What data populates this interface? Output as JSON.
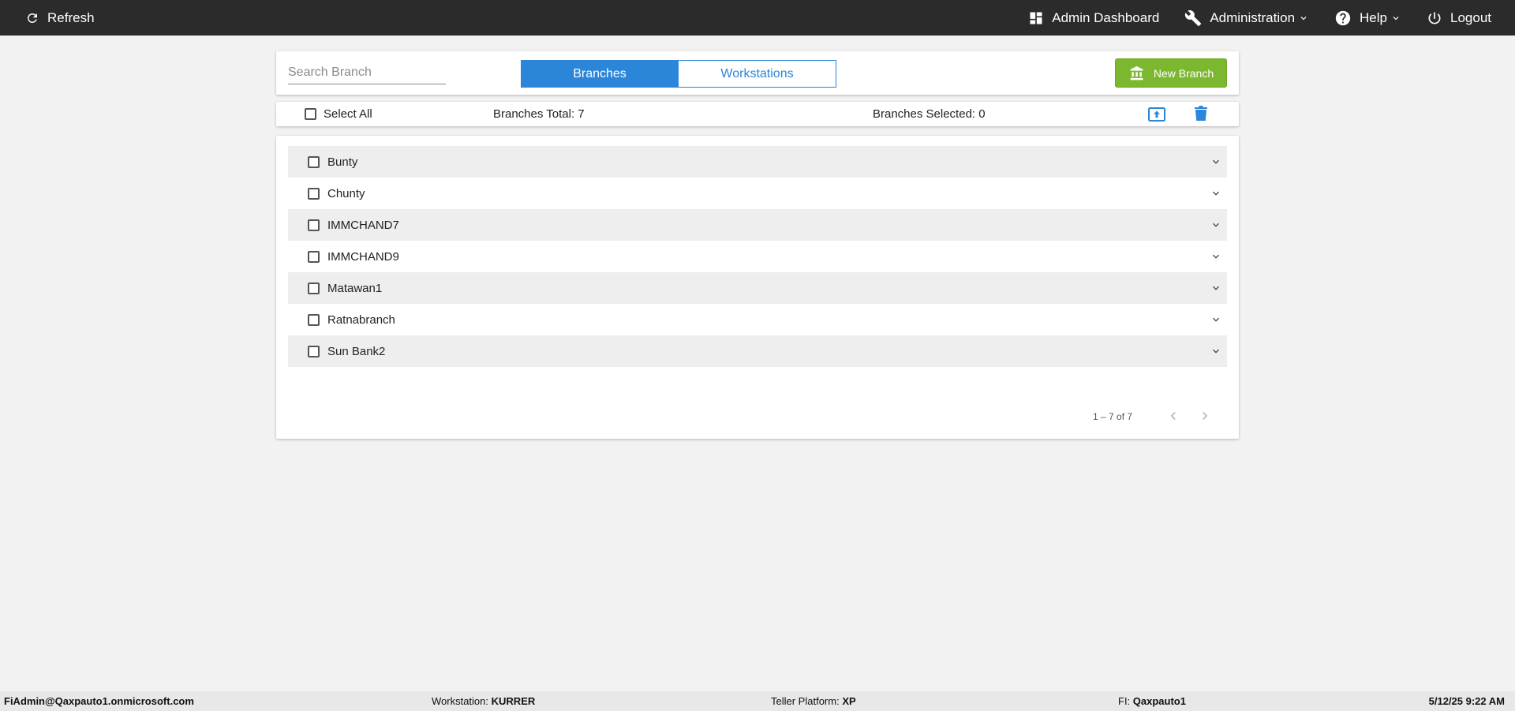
{
  "topbar": {
    "refresh_label": "Refresh",
    "admin_dashboard_label": "Admin Dashboard",
    "administration_label": "Administration",
    "help_label": "Help",
    "logout_label": "Logout"
  },
  "toolbar": {
    "search_placeholder": "Search Branch",
    "tabs": [
      {
        "label": "Branches",
        "active": true
      },
      {
        "label": "Workstations",
        "active": false
      }
    ],
    "new_branch_label": "New Branch"
  },
  "summary": {
    "select_all_label": "Select All",
    "branches_total": "Branches Total: 7",
    "branches_selected": "Branches Selected: 0"
  },
  "branches": [
    {
      "name": "Bunty"
    },
    {
      "name": "Chunty"
    },
    {
      "name": "IMMCHAND7"
    },
    {
      "name": "IMMCHAND9"
    },
    {
      "name": "Matawan1"
    },
    {
      "name": "Ratnabranch"
    },
    {
      "name": "Sun Bank2"
    }
  ],
  "pagination": {
    "range_label": "1 – 7 of 7"
  },
  "footer": {
    "user": "FiAdmin@Qaxpauto1.onmicrosoft.com",
    "workstation_label": "Workstation:",
    "workstation_value": "KURRER",
    "platform_label": "Teller Platform:",
    "platform_value": "XP",
    "fi_label": "FI:",
    "fi_value": "Qaxpauto1",
    "datetime": "5/12/25 9:22 AM"
  },
  "colors": {
    "topbar": "#2b2b2b",
    "accent_blue": "#2b86d9",
    "new_branch_green": "#7cb82f",
    "background": "#f2f2f2"
  },
  "icons": {
    "refresh": "refresh-icon",
    "dashboard": "dashboard-icon",
    "administration": "wrench-icon",
    "help": "help-circle-icon",
    "logout": "power-icon",
    "new_branch": "bank-icon",
    "upload": "upload-icon",
    "delete": "trash-icon",
    "expand": "chevron-down-icon",
    "prev": "chevron-left-icon",
    "next": "chevron-right-icon"
  }
}
